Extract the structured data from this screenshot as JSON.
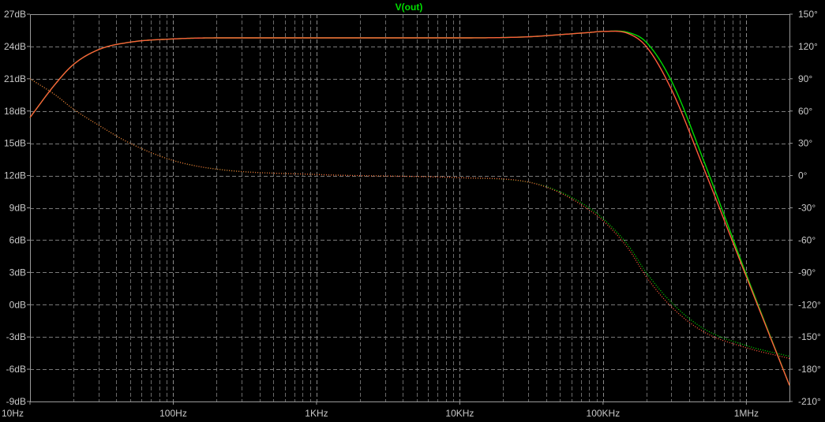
{
  "chart_data": {
    "type": "line",
    "title": "V(out)",
    "x_scale": "log",
    "xlim": [
      10,
      2000000
    ],
    "x_tick_labels": [
      {
        "x": 10,
        "label": "10Hz"
      },
      {
        "x": 100,
        "label": "100Hz"
      },
      {
        "x": 1000,
        "label": "1KHz"
      },
      {
        "x": 10000,
        "label": "10KHz"
      },
      {
        "x": 100000,
        "label": "100KHz"
      },
      {
        "x": 1000000,
        "label": "1MHz"
      }
    ],
    "y_left": {
      "unit": "dB",
      "ylim": [
        -9,
        27
      ],
      "ticks": [
        27,
        24,
        21,
        18,
        15,
        12,
        9,
        6,
        3,
        0,
        -3,
        -6,
        -9
      ],
      "tick_labels": [
        "27dB",
        "24dB",
        "21dB",
        "18dB",
        "15dB",
        "12dB",
        "9dB",
        "6dB",
        "3dB",
        "0dB",
        "-3dB",
        "-6dB",
        "-9dB"
      ]
    },
    "y_right": {
      "unit": "degrees",
      "ylim": [
        -210,
        150
      ],
      "ticks": [
        150,
        120,
        90,
        60,
        30,
        0,
        -30,
        -60,
        -90,
        -120,
        -150,
        -180,
        -210
      ],
      "tick_labels": [
        "150°",
        "120°",
        "90°",
        "60°",
        "30°",
        "0°",
        "-30°",
        "-60°",
        "-90°",
        "-120°",
        "-150°",
        "-180°",
        "-210°"
      ]
    },
    "grid": true,
    "series": [
      {
        "color": "#00dd00",
        "kind": "magnitude",
        "axis": "left",
        "x": [
          10,
          15,
          20,
          30,
          50,
          100,
          200,
          1000,
          10000,
          30000,
          50000,
          80000,
          100000,
          150000,
          200000,
          300000,
          500000,
          1000000,
          2000000
        ],
        "y": [
          17.4,
          20.5,
          22.3,
          23.7,
          24.4,
          24.7,
          24.8,
          24.8,
          24.8,
          24.9,
          25.1,
          25.3,
          25.4,
          25.3,
          24.4,
          20.8,
          13.5,
          2.8,
          -7.5
        ]
      },
      {
        "color": "#00dd00",
        "kind": "phase",
        "axis": "right",
        "x": [
          10,
          15,
          20,
          30,
          50,
          100,
          200,
          1000,
          10000,
          30000,
          50000,
          80000,
          100000,
          150000,
          200000,
          300000,
          500000,
          1000000,
          2000000
        ],
        "y": [
          90,
          75,
          62,
          47,
          30,
          14,
          6,
          1,
          -2,
          -6,
          -15,
          -30,
          -40,
          -65,
          -90,
          -118,
          -142,
          -158,
          -168
        ]
      },
      {
        "color": "#ff5a3c",
        "kind": "magnitude",
        "axis": "left",
        "x": [
          10,
          15,
          20,
          30,
          50,
          100,
          200,
          1000,
          10000,
          30000,
          50000,
          80000,
          100000,
          150000,
          200000,
          300000,
          500000,
          1000000,
          2000000
        ],
        "y": [
          17.4,
          20.5,
          22.3,
          23.7,
          24.4,
          24.7,
          24.8,
          24.8,
          24.8,
          24.9,
          25.1,
          25.3,
          25.4,
          25.2,
          24.0,
          20.0,
          12.8,
          2.6,
          -7.5
        ]
      },
      {
        "color": "#ff5a3c",
        "kind": "phase",
        "axis": "right",
        "x": [
          10,
          15,
          20,
          30,
          50,
          100,
          200,
          1000,
          10000,
          30000,
          50000,
          80000,
          100000,
          150000,
          200000,
          300000,
          500000,
          1000000,
          2000000
        ],
        "y": [
          90,
          75,
          62,
          47,
          30,
          14,
          6,
          1,
          -2,
          -6,
          -16,
          -32,
          -42,
          -68,
          -94,
          -122,
          -145,
          -160,
          -170
        ]
      }
    ]
  }
}
